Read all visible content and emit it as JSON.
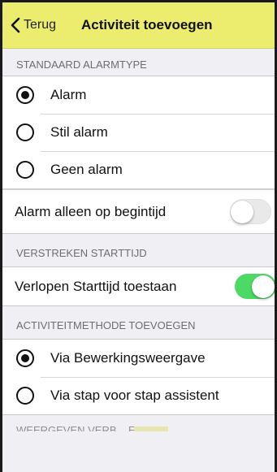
{
  "navbar": {
    "back_label": "Terug",
    "title": "Activiteit toevoegen",
    "icon": "chevron-left-icon",
    "color": "#ecec6e"
  },
  "sections": {
    "alarm_type": {
      "header": "STANDAARD ALARMTYPE",
      "options": [
        {
          "label": "Alarm",
          "selected": true
        },
        {
          "label": "Stil alarm",
          "selected": false
        },
        {
          "label": "Geen alarm",
          "selected": false
        }
      ],
      "begin_only": {
        "label": "Alarm alleen op begintijd",
        "on": false
      }
    },
    "expired": {
      "header": "VERSTREKEN STARTTIJD",
      "allow": {
        "label": "Verlopen Starttijd toestaan",
        "on": true,
        "color": "#4cd964"
      }
    },
    "method": {
      "header": "ACTIVITEITMETHODE TOEVOEGEN",
      "options": [
        {
          "label": "Via Bewerkingsweergave",
          "selected": true
        },
        {
          "label": "Via stap voor stap assistent",
          "selected": false
        }
      ]
    },
    "next_header": "WEERGEVEN VERB... EN"
  }
}
